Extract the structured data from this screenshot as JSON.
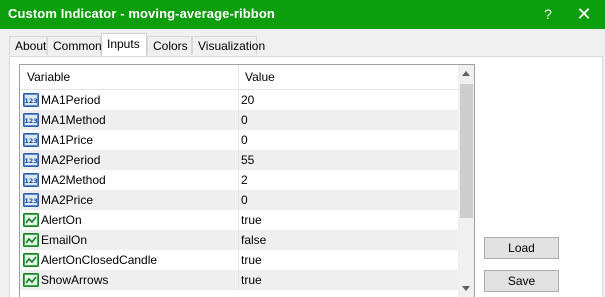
{
  "window": {
    "title": "Custom Indicator - moving-average-ribbon",
    "help_label": "?",
    "close_label": "✕"
  },
  "tabs": [
    {
      "label": "About",
      "active": false
    },
    {
      "label": "Common",
      "active": false
    },
    {
      "label": "Inputs",
      "active": true
    },
    {
      "label": "Colors",
      "active": false
    },
    {
      "label": "Visualization",
      "active": false
    }
  ],
  "table": {
    "headers": {
      "variable": "Variable",
      "value": "Value"
    },
    "rows": [
      {
        "name": "MA1Period",
        "value": "20",
        "icon": "integer-icon"
      },
      {
        "name": "MA1Method",
        "value": "0",
        "icon": "integer-icon"
      },
      {
        "name": "MA1Price",
        "value": "0",
        "icon": "integer-icon"
      },
      {
        "name": "MA2Period",
        "value": "55",
        "icon": "integer-icon"
      },
      {
        "name": "MA2Method",
        "value": "2",
        "icon": "integer-icon"
      },
      {
        "name": "MA2Price",
        "value": "0",
        "icon": "integer-icon"
      },
      {
        "name": "AlertOn",
        "value": "true",
        "icon": "boolean-icon"
      },
      {
        "name": "EmailOn",
        "value": "false",
        "icon": "boolean-icon"
      },
      {
        "name": "AlertOnClosedCandle",
        "value": "true",
        "icon": "boolean-icon"
      },
      {
        "name": "ShowArrows",
        "value": "true",
        "icon": "boolean-icon"
      }
    ]
  },
  "buttons": {
    "load": "Load",
    "save": "Save"
  },
  "colors": {
    "titlebar": "#0c9e0c",
    "integer_icon": "#4a7fc4",
    "boolean_icon": "#2fa33a"
  }
}
